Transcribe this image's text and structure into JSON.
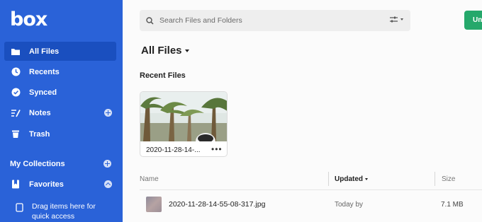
{
  "brand": {
    "logo_text": "box"
  },
  "sidebar": {
    "items": [
      {
        "label": "All Files",
        "icon": "folder-icon",
        "active": true
      },
      {
        "label": "Recents",
        "icon": "clock-icon"
      },
      {
        "label": "Synced",
        "icon": "check-circle-icon"
      },
      {
        "label": "Notes",
        "icon": "notes-icon"
      },
      {
        "label": "Trash",
        "icon": "trash-icon"
      }
    ],
    "collections_label": "My Collections",
    "favorites_label": "Favorites",
    "drag_hint_line1": "Drag items here for",
    "drag_hint_line2": "quick access"
  },
  "search": {
    "placeholder": "Search Files and Folders"
  },
  "new_button_label": "Un",
  "main": {
    "title": "All Files",
    "recent_heading": "Recent Files",
    "recent_card": {
      "name": "2020-11-28-14-...",
      "more": "•••"
    },
    "columns": {
      "name": "Name",
      "updated": "Updated",
      "size": "Size"
    },
    "rows": [
      {
        "name": "2020-11-28-14-55-08-317.jpg",
        "updated": "Today by",
        "size": "7.1 MB"
      }
    ]
  },
  "colors": {
    "sidebar": "#2a62d8",
    "active_item": "#1a4fbf",
    "new_button": "#25a86b"
  }
}
